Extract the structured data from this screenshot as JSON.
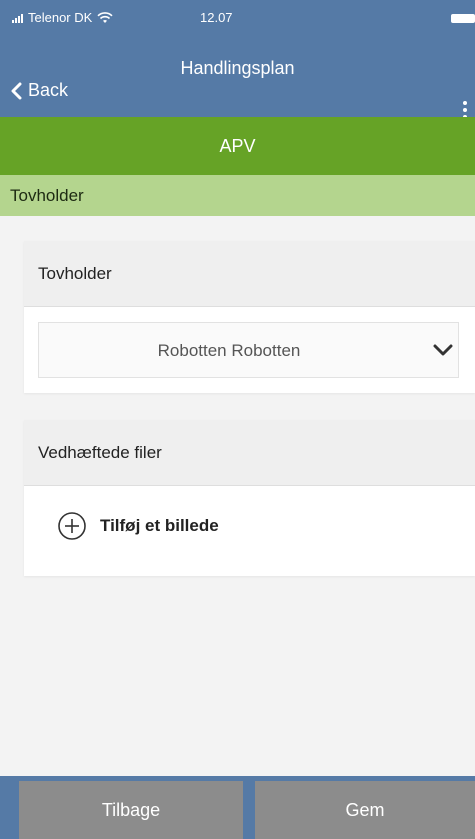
{
  "status_bar": {
    "carrier": "Telenor DK",
    "time": "12.07"
  },
  "nav": {
    "title": "Handlingsplan",
    "back_label": "Back"
  },
  "apv_band": {
    "label": "APV"
  },
  "section_band": {
    "label": "Tovholder"
  },
  "owner_card": {
    "header": "Tovholder",
    "selected_value": "Robotten Robotten"
  },
  "files_card": {
    "header": "Vedhæftede filer",
    "add_label": "Tilføj et billede"
  },
  "footer": {
    "back_label": "Tilbage",
    "save_label": "Gem"
  },
  "colors": {
    "header_blue": "#557aa6",
    "apv_green": "#66a326",
    "section_light_green": "#b4d58e",
    "footer_button_gray": "#8c8c8c"
  },
  "icons": [
    "signal-icon",
    "wifi-icon",
    "battery-icon",
    "chevron-left-icon",
    "more-vertical-icon",
    "chevron-down-icon",
    "plus-circle-icon"
  ]
}
